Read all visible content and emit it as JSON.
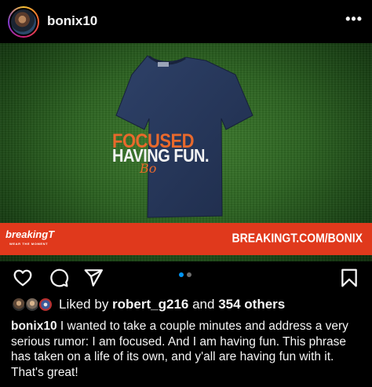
{
  "header": {
    "username": "bonix10",
    "more_glyph": "•••"
  },
  "post": {
    "shirt_line1": "FOCUSED",
    "shirt_line2": "HAVING FUN.",
    "shirt_signature": "Bo",
    "brand": "breakingT",
    "brand_tagline": "WEAR THE MOMENT",
    "banner_url": "BREAKINGT.COM/BONIX",
    "colors": {
      "banner": "#e0391c",
      "shirt": "#26375a",
      "accent": "#e9692c"
    }
  },
  "actions": {
    "icons": [
      "heart-icon",
      "comment-icon",
      "share-icon",
      "bookmark-icon"
    ],
    "carousel_total": 2,
    "carousel_active": 1
  },
  "likes": {
    "prefix": "Liked by ",
    "user": "robert_g216",
    "middle": " and ",
    "others": "354 others"
  },
  "caption": {
    "username": "bonix10",
    "text": " I wanted to take a couple minutes and address a very serious rumor: I am focused. And I am having fun. This phrase has taken on a life of its own, and y'all are having fun with it. That's great!"
  }
}
